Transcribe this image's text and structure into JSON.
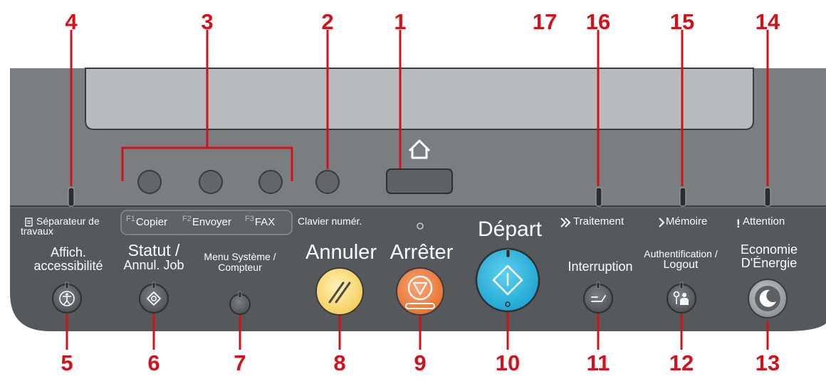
{
  "colors": {
    "panel_top": "#7a7d80",
    "panel_lower": "#55585b",
    "screen": "#b9bcbf",
    "callout": "#d3111b",
    "clear_button": "#fbe08a",
    "stop_button": "#f2874b",
    "start_button": "#35b8de"
  },
  "callouts": {
    "n1": "1",
    "n2": "2",
    "n3": "3",
    "n4": "4",
    "n5": "5",
    "n6": "6",
    "n7": "7",
    "n8": "8",
    "n9": "9",
    "n10": "10",
    "n11": "11",
    "n12": "12",
    "n13": "13",
    "n14": "14",
    "n15": "15",
    "n16": "16",
    "n17": "17"
  },
  "labels": {
    "job_separator": [
      "Séparateur de",
      "travaux"
    ],
    "accessibility": [
      "Affich.",
      "accessibilité"
    ],
    "status": [
      "Statut /",
      "Annul. Job"
    ],
    "system_menu": [
      "Menu Système /",
      "Compteur"
    ],
    "clear": "Annuler",
    "stop": "Arrêter",
    "start": "Départ",
    "interrupt": "Interruption",
    "auth": [
      "Authentification /",
      "Logout"
    ],
    "energy": [
      "Economie",
      "D'Énergie"
    ],
    "f1_key": "F1",
    "f1": "Copier",
    "f2_key": "F2",
    "f2": "Envoyer",
    "f3_key": "F3",
    "f3": "FAX",
    "keypad": "Clavier numér.",
    "processing": "Traitement",
    "memory": "Mémoire",
    "attention": "Attention"
  }
}
